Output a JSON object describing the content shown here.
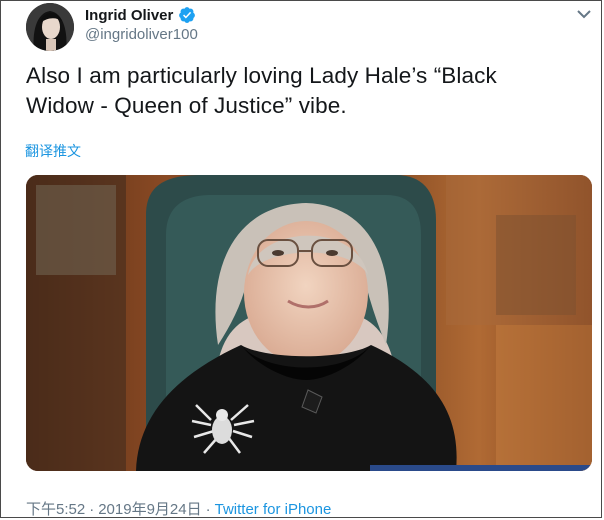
{
  "author": {
    "name": "Ingrid Oliver",
    "handle": "@ingridoliver100"
  },
  "tweet": {
    "text_line1": "Also I am particularly loving Lady Hale’s “Black",
    "text_line2": "Widow - Queen of Justice” vibe."
  },
  "translate_label": "翻译推文",
  "footer": {
    "time": "下午5:52",
    "separator": "·",
    "date": "2019年9月24日",
    "source": "Twitter for iPhone"
  },
  "icons": {
    "verified": "verified-badge-icon",
    "menu": "chevron-down-icon"
  },
  "colors": {
    "link": "#1b95e0",
    "verified": "#1da1f2",
    "secondary_text": "#657786",
    "primary_text": "#14171a"
  }
}
